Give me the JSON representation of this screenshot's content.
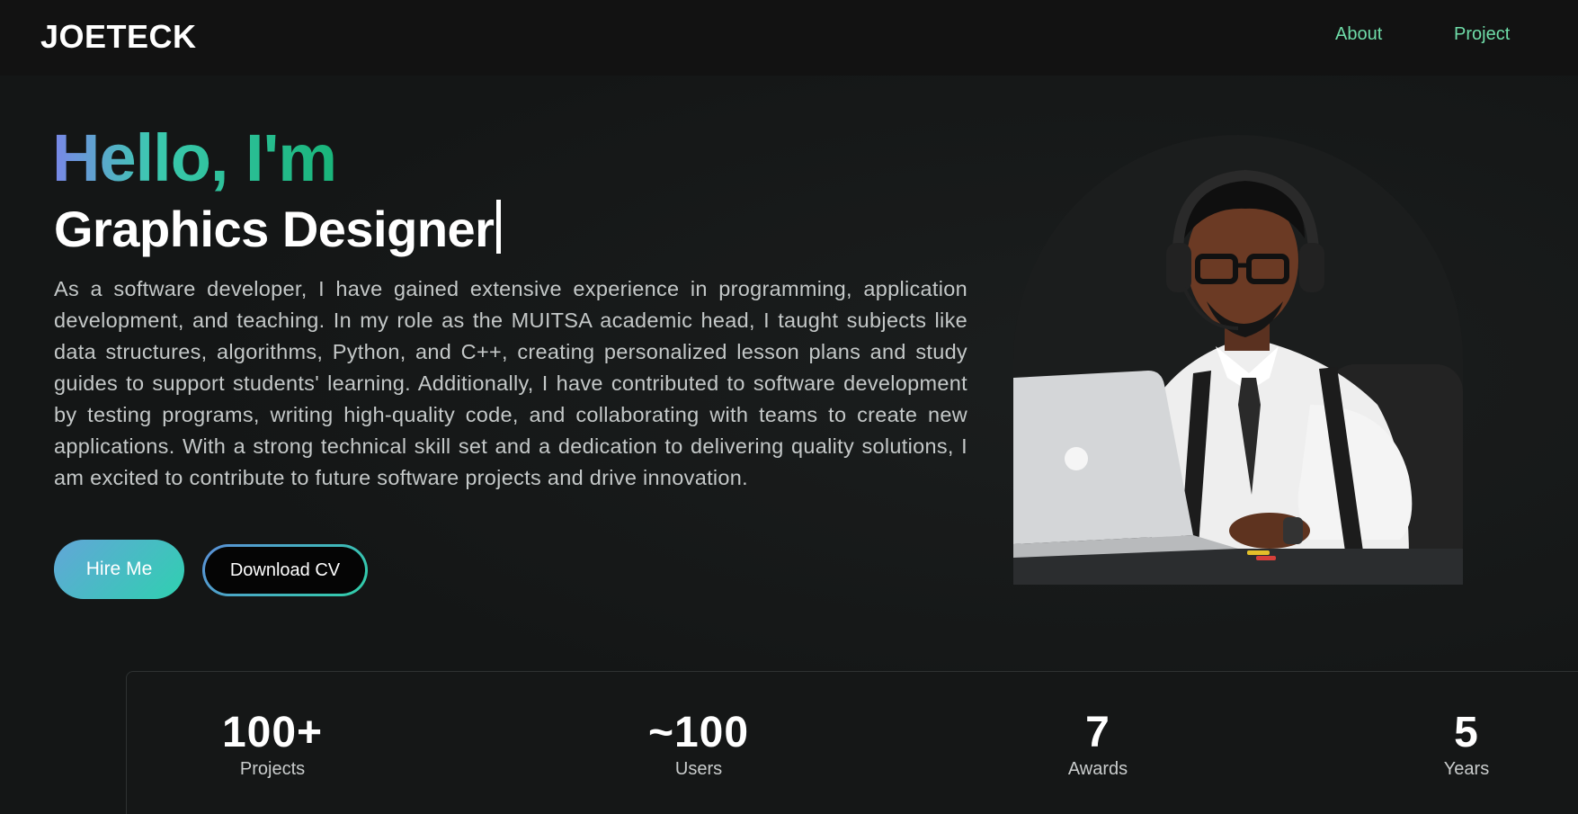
{
  "nav": {
    "brand": "JOETECK",
    "links": [
      {
        "label": "About"
      },
      {
        "label": "Project"
      }
    ]
  },
  "hero": {
    "greeting": "Hello, I'm",
    "role": "Graphics Designer",
    "bio": "As a software developer, I have gained extensive experience in programming, application development, and teaching. In my role as the MUITSA academic head, I taught subjects like data structures, algorithms, Python, and C++, creating personalized lesson plans and study guides to support students' learning. Additionally, I have contributed to software development by testing programs, writing high-quality code, and collaborating with teams to create new applications. With a strong technical skill set and a dedication to delivering quality solutions, I am excited to contribute to future software projects and drive innovation.",
    "hire_label": "Hire Me",
    "cv_label": "Download CV"
  },
  "stats": [
    {
      "value": "100+",
      "label": "Projects"
    },
    {
      "value": "~100",
      "label": "Users"
    },
    {
      "value": "7",
      "label": "Awards"
    },
    {
      "value": "5",
      "label": "Years"
    }
  ],
  "colors": {
    "accent": "#6fdca8",
    "gradient_start": "#7a86e8",
    "gradient_end": "#19b57a",
    "background": "#141616"
  }
}
